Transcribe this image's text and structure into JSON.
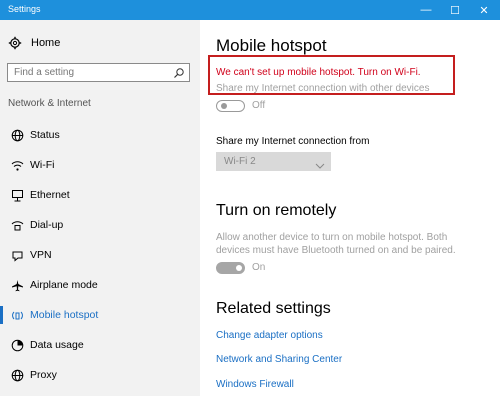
{
  "window": {
    "title": "Settings",
    "minimize": "—",
    "maximize": "☐",
    "close": "✕"
  },
  "sidebar": {
    "home_label": "Home",
    "search_placeholder": "Find a setting",
    "section_label": "Network & Internet",
    "items": [
      {
        "label": "Status",
        "icon": "globe-icon"
      },
      {
        "label": "Wi-Fi",
        "icon": "wifi-icon"
      },
      {
        "label": "Ethernet",
        "icon": "ethernet-icon"
      },
      {
        "label": "Dial-up",
        "icon": "dialup-icon"
      },
      {
        "label": "VPN",
        "icon": "vpn-icon"
      },
      {
        "label": "Airplane mode",
        "icon": "airplane-icon"
      },
      {
        "label": "Mobile hotspot",
        "icon": "hotspot-icon",
        "active": true
      },
      {
        "label": "Data usage",
        "icon": "data-usage-icon"
      },
      {
        "label": "Proxy",
        "icon": "proxy-globe-icon"
      }
    ]
  },
  "main": {
    "title": "Mobile hotspot",
    "error_text": "We can't set up mobile hotspot. Turn on Wi-Fi.",
    "share_desc": "Share my Internet connection with other devices",
    "share_toggle_state": "Off",
    "share_from_label": "Share my Internet connection from",
    "share_from_value": "Wi-Fi 2",
    "remote_title": "Turn on remotely",
    "remote_desc": "Allow another device to turn on mobile hotspot. Both devices must have Bluetooth turned on and be paired.",
    "remote_toggle_state": "On",
    "related_title": "Related settings",
    "links": [
      "Change adapter options",
      "Network and Sharing Center",
      "Windows Firewall"
    ]
  },
  "colors": {
    "titlebar": "#1e90dc",
    "accent": "#1a6fc4",
    "error": "#d0021b",
    "highlight_box": "#c41e1e",
    "sidebar_bg": "#f2f2f2"
  }
}
